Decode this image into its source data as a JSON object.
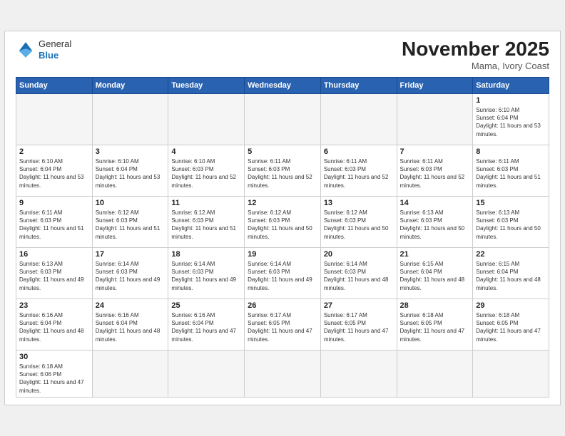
{
  "header": {
    "logo_general": "General",
    "logo_blue": "Blue",
    "month_title": "November 2025",
    "subtitle": "Mama, Ivory Coast"
  },
  "weekdays": [
    "Sunday",
    "Monday",
    "Tuesday",
    "Wednesday",
    "Thursday",
    "Friday",
    "Saturday"
  ],
  "weeks": [
    [
      {
        "day": "",
        "empty": true
      },
      {
        "day": "",
        "empty": true
      },
      {
        "day": "",
        "empty": true
      },
      {
        "day": "",
        "empty": true
      },
      {
        "day": "",
        "empty": true
      },
      {
        "day": "",
        "empty": true
      },
      {
        "day": "1",
        "sunrise": "Sunrise: 6:10 AM",
        "sunset": "Sunset: 6:04 PM",
        "daylight": "Daylight: 11 hours and 53 minutes."
      }
    ],
    [
      {
        "day": "2",
        "sunrise": "Sunrise: 6:10 AM",
        "sunset": "Sunset: 6:04 PM",
        "daylight": "Daylight: 11 hours and 53 minutes."
      },
      {
        "day": "3",
        "sunrise": "Sunrise: 6:10 AM",
        "sunset": "Sunset: 6:04 PM",
        "daylight": "Daylight: 11 hours and 53 minutes."
      },
      {
        "day": "4",
        "sunrise": "Sunrise: 6:10 AM",
        "sunset": "Sunset: 6:03 PM",
        "daylight": "Daylight: 11 hours and 52 minutes."
      },
      {
        "day": "5",
        "sunrise": "Sunrise: 6:11 AM",
        "sunset": "Sunset: 6:03 PM",
        "daylight": "Daylight: 11 hours and 52 minutes."
      },
      {
        "day": "6",
        "sunrise": "Sunrise: 6:11 AM",
        "sunset": "Sunset: 6:03 PM",
        "daylight": "Daylight: 11 hours and 52 minutes."
      },
      {
        "day": "7",
        "sunrise": "Sunrise: 6:11 AM",
        "sunset": "Sunset: 6:03 PM",
        "daylight": "Daylight: 11 hours and 52 minutes."
      },
      {
        "day": "8",
        "sunrise": "Sunrise: 6:11 AM",
        "sunset": "Sunset: 6:03 PM",
        "daylight": "Daylight: 11 hours and 51 minutes."
      }
    ],
    [
      {
        "day": "9",
        "sunrise": "Sunrise: 6:11 AM",
        "sunset": "Sunset: 6:03 PM",
        "daylight": "Daylight: 11 hours and 51 minutes."
      },
      {
        "day": "10",
        "sunrise": "Sunrise: 6:12 AM",
        "sunset": "Sunset: 6:03 PM",
        "daylight": "Daylight: 11 hours and 51 minutes."
      },
      {
        "day": "11",
        "sunrise": "Sunrise: 6:12 AM",
        "sunset": "Sunset: 6:03 PM",
        "daylight": "Daylight: 11 hours and 51 minutes."
      },
      {
        "day": "12",
        "sunrise": "Sunrise: 6:12 AM",
        "sunset": "Sunset: 6:03 PM",
        "daylight": "Daylight: 11 hours and 50 minutes."
      },
      {
        "day": "13",
        "sunrise": "Sunrise: 6:12 AM",
        "sunset": "Sunset: 6:03 PM",
        "daylight": "Daylight: 11 hours and 50 minutes."
      },
      {
        "day": "14",
        "sunrise": "Sunrise: 6:13 AM",
        "sunset": "Sunset: 6:03 PM",
        "daylight": "Daylight: 11 hours and 50 minutes."
      },
      {
        "day": "15",
        "sunrise": "Sunrise: 6:13 AM",
        "sunset": "Sunset: 6:03 PM",
        "daylight": "Daylight: 11 hours and 50 minutes."
      }
    ],
    [
      {
        "day": "16",
        "sunrise": "Sunrise: 6:13 AM",
        "sunset": "Sunset: 6:03 PM",
        "daylight": "Daylight: 11 hours and 49 minutes."
      },
      {
        "day": "17",
        "sunrise": "Sunrise: 6:14 AM",
        "sunset": "Sunset: 6:03 PM",
        "daylight": "Daylight: 11 hours and 49 minutes."
      },
      {
        "day": "18",
        "sunrise": "Sunrise: 6:14 AM",
        "sunset": "Sunset: 6:03 PM",
        "daylight": "Daylight: 11 hours and 49 minutes."
      },
      {
        "day": "19",
        "sunrise": "Sunrise: 6:14 AM",
        "sunset": "Sunset: 6:03 PM",
        "daylight": "Daylight: 11 hours and 49 minutes."
      },
      {
        "day": "20",
        "sunrise": "Sunrise: 6:14 AM",
        "sunset": "Sunset: 6:03 PM",
        "daylight": "Daylight: 11 hours and 48 minutes."
      },
      {
        "day": "21",
        "sunrise": "Sunrise: 6:15 AM",
        "sunset": "Sunset: 6:04 PM",
        "daylight": "Daylight: 11 hours and 48 minutes."
      },
      {
        "day": "22",
        "sunrise": "Sunrise: 6:15 AM",
        "sunset": "Sunset: 6:04 PM",
        "daylight": "Daylight: 11 hours and 48 minutes."
      }
    ],
    [
      {
        "day": "23",
        "sunrise": "Sunrise: 6:16 AM",
        "sunset": "Sunset: 6:04 PM",
        "daylight": "Daylight: 11 hours and 48 minutes."
      },
      {
        "day": "24",
        "sunrise": "Sunrise: 6:16 AM",
        "sunset": "Sunset: 6:04 PM",
        "daylight": "Daylight: 11 hours and 48 minutes."
      },
      {
        "day": "25",
        "sunrise": "Sunrise: 6:16 AM",
        "sunset": "Sunset: 6:04 PM",
        "daylight": "Daylight: 11 hours and 47 minutes."
      },
      {
        "day": "26",
        "sunrise": "Sunrise: 6:17 AM",
        "sunset": "Sunset: 6:05 PM",
        "daylight": "Daylight: 11 hours and 47 minutes."
      },
      {
        "day": "27",
        "sunrise": "Sunrise: 6:17 AM",
        "sunset": "Sunset: 6:05 PM",
        "daylight": "Daylight: 11 hours and 47 minutes."
      },
      {
        "day": "28",
        "sunrise": "Sunrise: 6:18 AM",
        "sunset": "Sunset: 6:05 PM",
        "daylight": "Daylight: 11 hours and 47 minutes."
      },
      {
        "day": "29",
        "sunrise": "Sunrise: 6:18 AM",
        "sunset": "Sunset: 6:05 PM",
        "daylight": "Daylight: 11 hours and 47 minutes."
      }
    ],
    [
      {
        "day": "30",
        "sunrise": "Sunrise: 6:18 AM",
        "sunset": "Sunset: 6:06 PM",
        "daylight": "Daylight: 11 hours and 47 minutes."
      },
      {
        "day": "",
        "empty": true
      },
      {
        "day": "",
        "empty": true
      },
      {
        "day": "",
        "empty": true
      },
      {
        "day": "",
        "empty": true
      },
      {
        "day": "",
        "empty": true
      },
      {
        "day": "",
        "empty": true
      }
    ]
  ]
}
